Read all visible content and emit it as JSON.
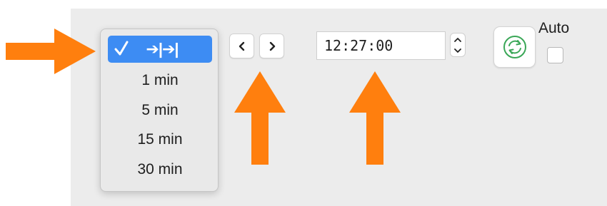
{
  "menu": {
    "selected_glyph": "➔|➔|",
    "items": [
      {
        "label": "1 min"
      },
      {
        "label": "5 min"
      },
      {
        "label": "15 min"
      },
      {
        "label": "30 min"
      }
    ]
  },
  "time_field": {
    "value": "12:27:00"
  },
  "auto": {
    "label": "Auto",
    "checked": false
  },
  "colors": {
    "accent": "#3d8cf3",
    "annotation_arrow": "#ff7f0e",
    "refresh_green": "#3aa757"
  },
  "icons": [
    "checkmark-icon",
    "chevron-left-icon",
    "chevron-right-icon",
    "stepper-up-icon",
    "stepper-down-icon",
    "refresh-icon"
  ]
}
